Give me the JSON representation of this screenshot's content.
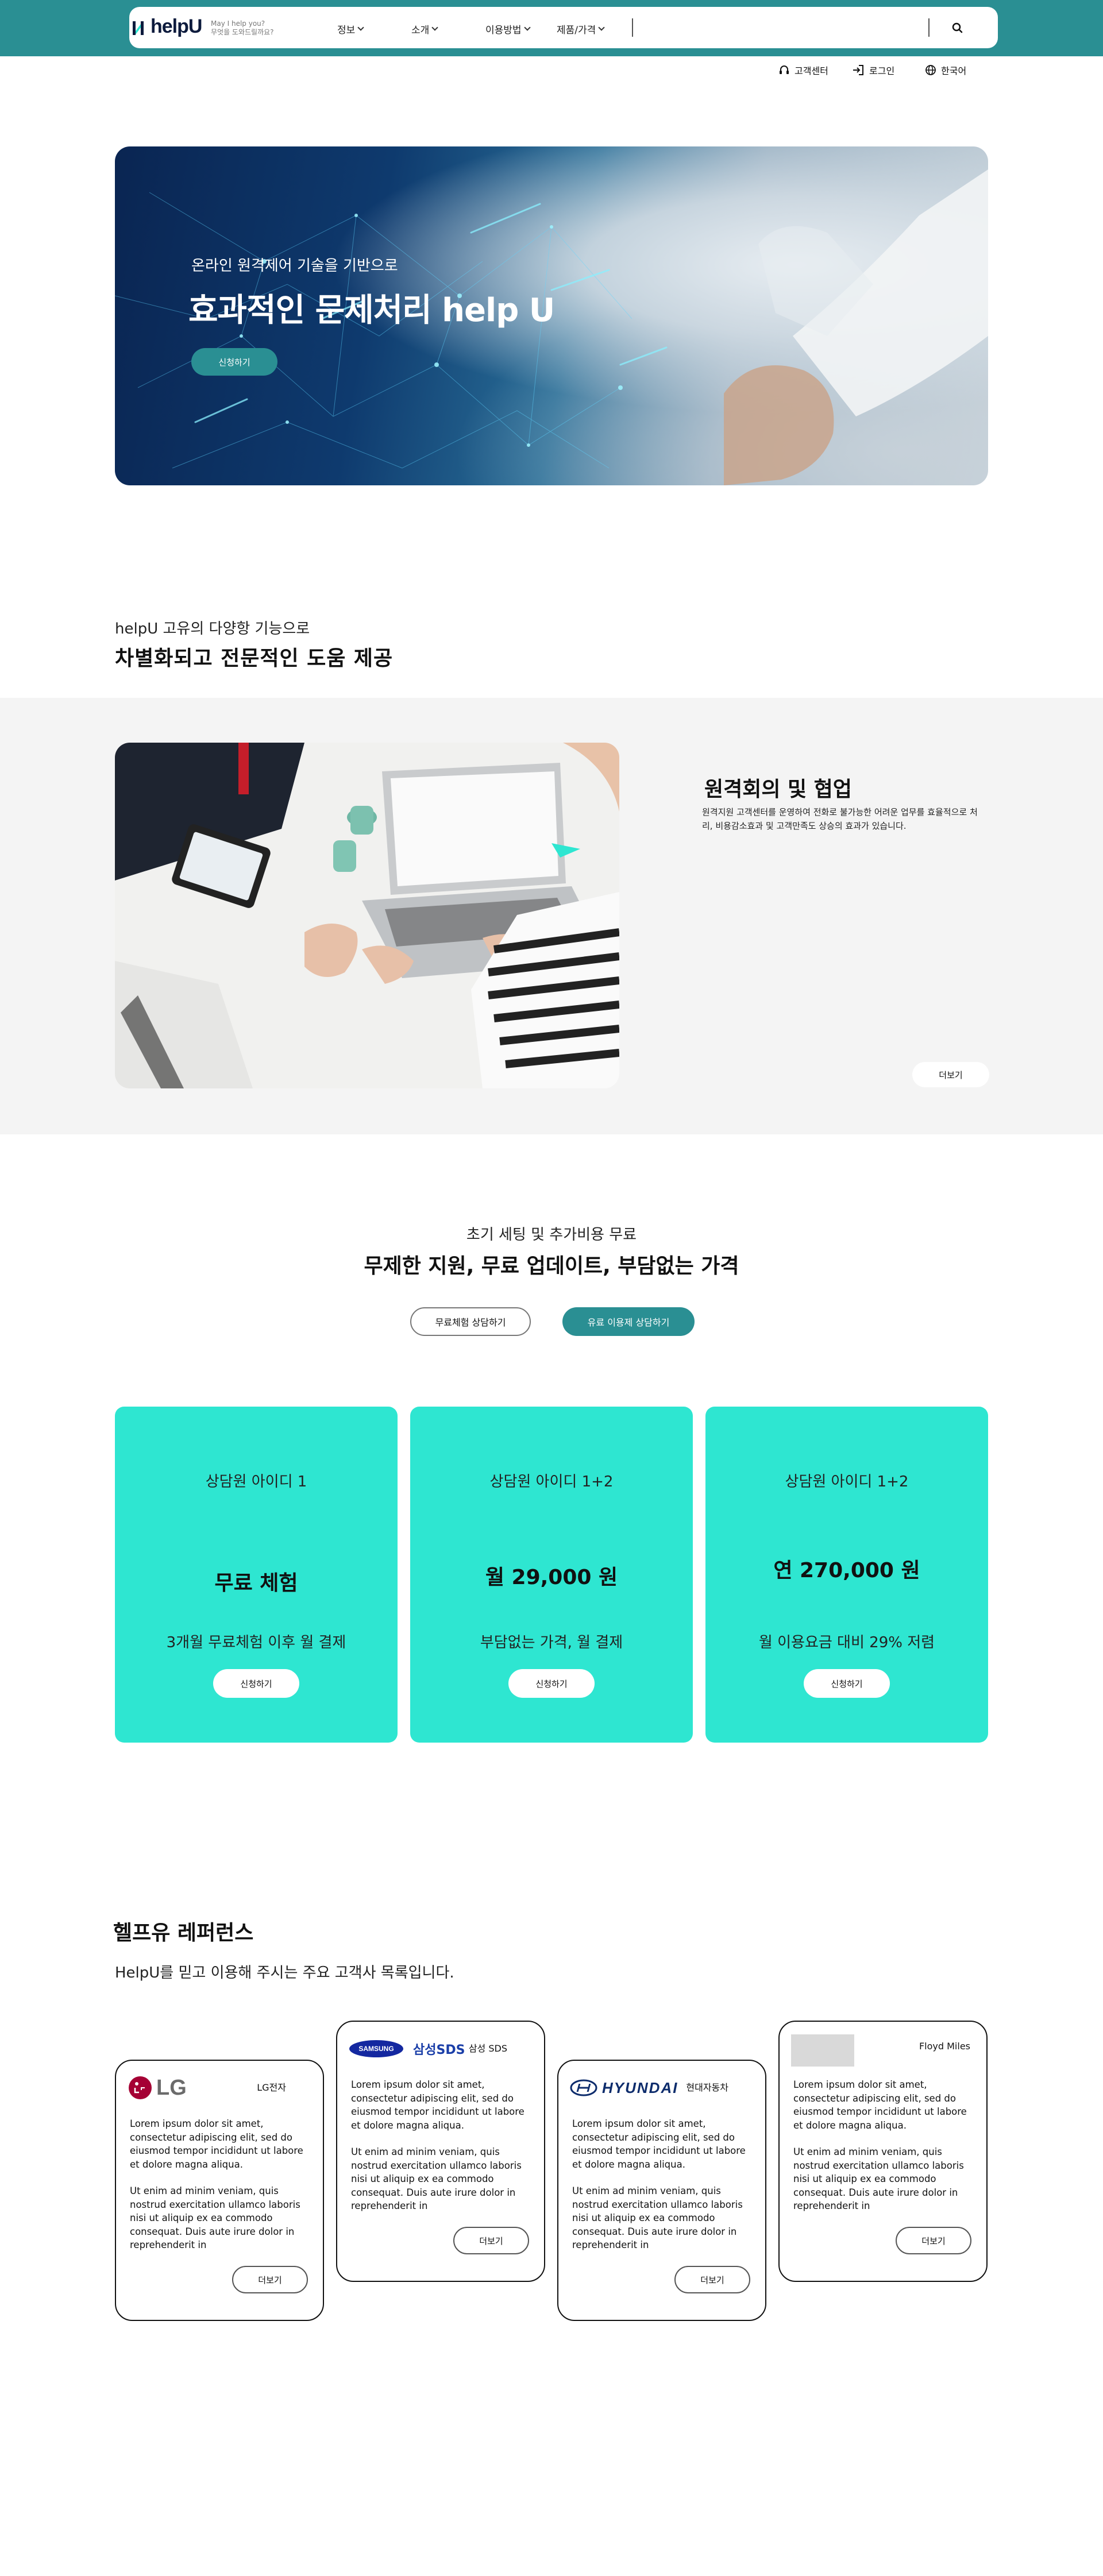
{
  "header": {
    "logo_text": "helpU",
    "logo_sub_line1": "May I help you?",
    "logo_sub_line2": "무엇을 도와드릴까요?",
    "menu": [
      {
        "label": "정보"
      },
      {
        "label": "소개"
      },
      {
        "label": "이용방법"
      },
      {
        "label": "제품/가격"
      }
    ],
    "search_placeholder": "",
    "utility": {
      "support": "고객센터",
      "login": "로그인",
      "language": "한국어"
    }
  },
  "hero": {
    "subtitle": "온라인 원격제어 기술을 기반으로",
    "title": "효과적인 문제처리 help U",
    "button": "신청하기"
  },
  "features": {
    "subtitle": "helpU 고유의 다양항 기능으로",
    "title": "차별화되고  전문적인  도움  제공",
    "item": {
      "title": "원격회의 및 협업",
      "description": "원격지원 고객센터를 운영하여 전화로 불가능한 어려운 업무를 효율적으로 처리, 비용감소효과 및 고객만족도 상승의 효과가 있습니다.",
      "more": "더보기"
    }
  },
  "pricing": {
    "subtitle": "초기 세팅 및 추가비용 무료",
    "title": "무제한 지원, 무료 업데이트, 부담없는 가격",
    "btn_free": "무료체험 상담하기",
    "btn_paid": "유료 이용제 상담하기",
    "plans": [
      {
        "name": "상담원 아이디 1",
        "price": "무료 체험",
        "desc": "3개월 무료체험 이후 월 결제",
        "button": "신청하기"
      },
      {
        "name": "상담원 아이디 1+2",
        "price": "월 29,000 원",
        "desc": "부담없는 가격, 월 결제",
        "button": "신청하기"
      },
      {
        "name": "상담원 아이디 1+2",
        "price": "연 270,000 원",
        "desc": "월 이용요금 대비 29% 저렴",
        "button": "신청하기"
      }
    ]
  },
  "references": {
    "title": "헬프유 레퍼런스",
    "subtitle": "HelpU를 믿고 이용해 주시는 주요 고객사 목록입니다.",
    "cards": [
      {
        "logo": "LG",
        "company": "LG전자",
        "p1": "Lorem ipsum dolor sit amet, consectetur adipiscing elit, sed do eiusmod tempor incididunt ut labore et dolore magna aliqua.",
        "p2": "Ut enim ad minim veniam, quis nostrud exercitation ullamco laboris nisi ut aliquip ex ea commodo consequat. Duis aute irure dolor in reprehenderit in",
        "more": "더보기"
      },
      {
        "logo": "SAMSUNG",
        "logo2": "삼성SDS",
        "company": "삼성 SDS",
        "p1": "Lorem ipsum dolor sit amet, consectetur adipiscing elit, sed do eiusmod tempor incididunt ut labore et dolore magna aliqua.",
        "p2": "Ut enim ad minim veniam, quis nostrud exercitation ullamco laboris nisi ut aliquip ex ea commodo consequat. Duis aute irure dolor in reprehenderit in",
        "more": "더보기"
      },
      {
        "logo": "HYUNDAI",
        "company": "현대자동차",
        "p1": "Lorem ipsum dolor sit amet, consectetur adipiscing elit, sed do eiusmod tempor incididunt ut labore et dolore magna aliqua.",
        "p2": "Ut enim ad minim veniam, quis nostrud exercitation ullamco laboris nisi ut aliquip ex ea commodo consequat. Duis aute irure dolor in reprehenderit in",
        "more": "더보기"
      },
      {
        "logo": "",
        "company": "Floyd Miles",
        "p1": "Lorem ipsum dolor sit amet, consectetur adipiscing elit, sed do eiusmod tempor incididunt ut labore et dolore magna aliqua.",
        "p2": "Ut enim ad minim veniam, quis nostrud exercitation ullamco laboris nisi ut aliquip ex ea commodo consequat. Duis aute irure dolor in reprehenderit in",
        "more": "더보기"
      }
    ]
  },
  "colors": {
    "brand_teal": "#2a8f93",
    "plan_card": "#2ee6d1",
    "section_gray": "#f4f4f4"
  }
}
